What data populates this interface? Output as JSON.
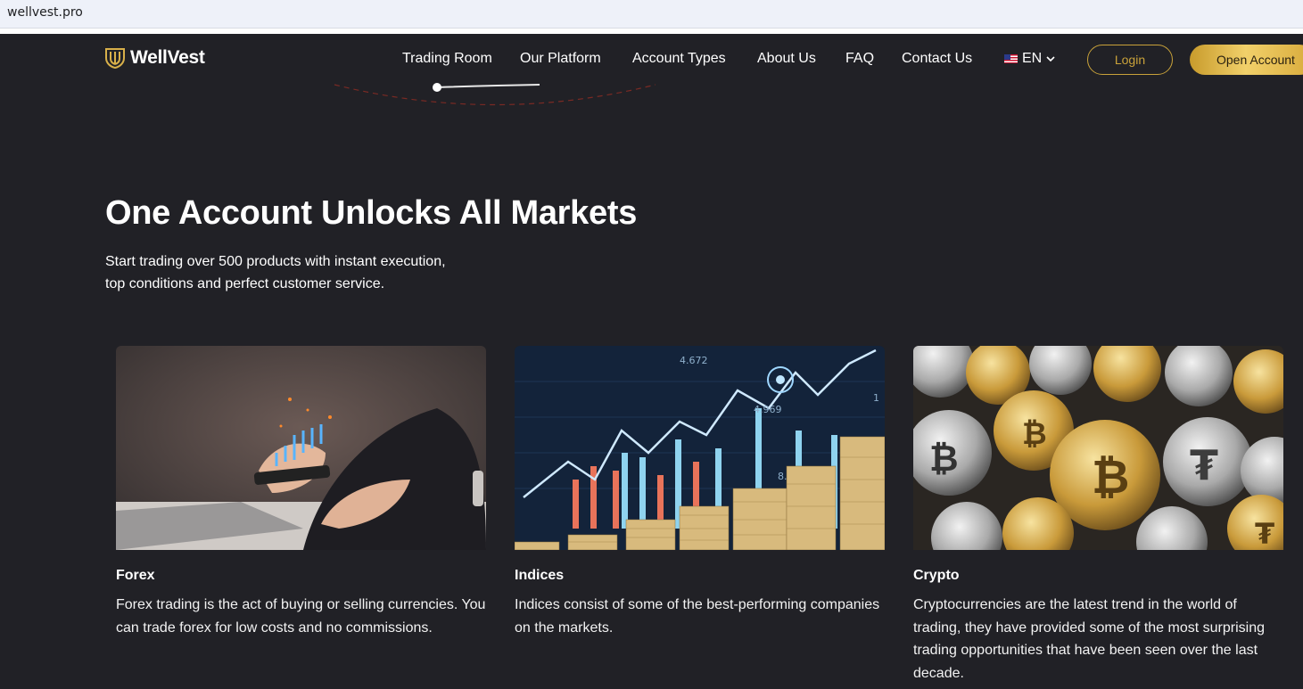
{
  "browser": {
    "url": "wellvest.pro"
  },
  "header": {
    "logo_text": "WellVest",
    "nav": [
      "Trading Room",
      "Our Platform",
      "Account Types",
      "About Us",
      "FAQ",
      "Contact Us"
    ],
    "language": "EN",
    "login_label": "Login",
    "open_account_label": "Open Account"
  },
  "hero": {
    "title": "One Account Unlocks All Markets",
    "subtitle_line1": "Start trading over 500 products with instant execution,",
    "subtitle_line2": "top conditions and perfect customer service."
  },
  "cards": [
    {
      "title": "Forex",
      "text": "Forex trading is the act of buying or selling currencies. You can trade forex for low costs and no commissions."
    },
    {
      "title": "Indices",
      "text": "Indices consist of some of the best-performing companies on the markets."
    },
    {
      "title": "Crypto",
      "text": "Cryptocurrencies are the latest trend in the world of trading, they have provided some of the most surprising trading opportunities that have been seen over the last decade."
    }
  ],
  "image_labels": {
    "indices_a": "4.672",
    "indices_b": "4.969",
    "indices_c": "8.3",
    "indices_d": "1"
  },
  "colors": {
    "background": "#212126",
    "gold": "#c9a23a",
    "accent_line": "#c0392b"
  }
}
